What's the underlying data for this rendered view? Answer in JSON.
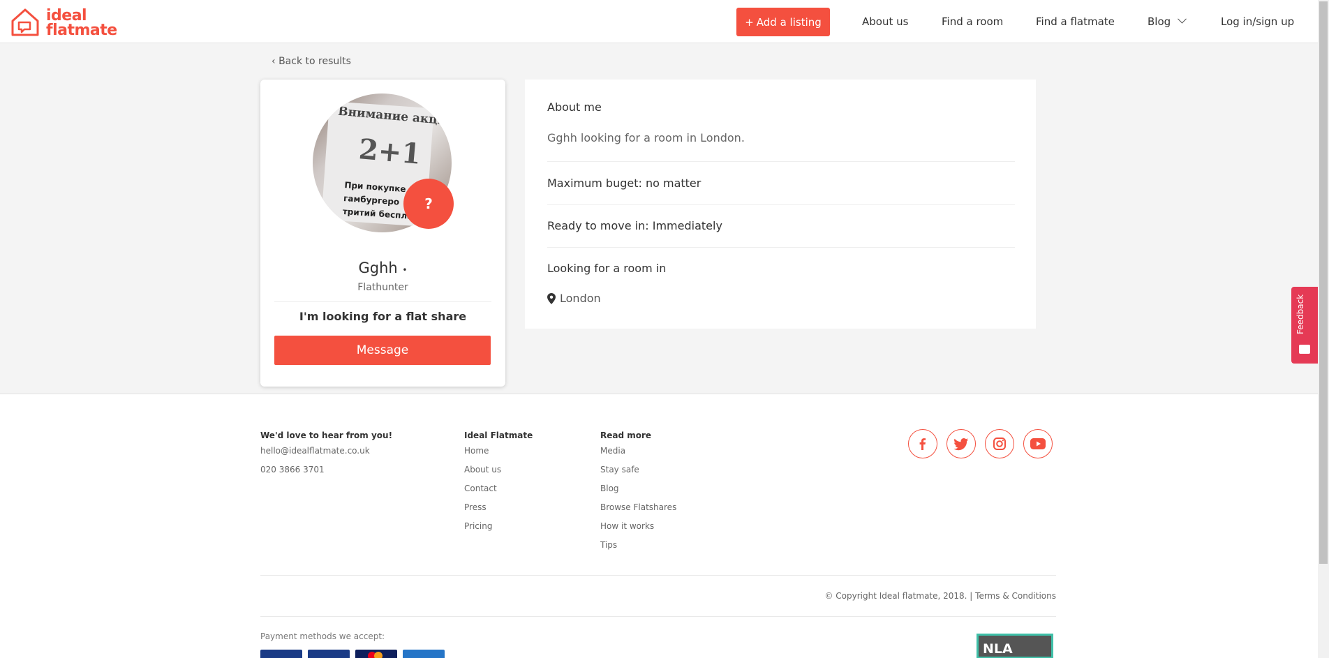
{
  "header": {
    "logo_line1": "ideal",
    "logo_line2": "flatmate",
    "add_listing": "Add a listing",
    "nav": [
      "About us",
      "Find a room",
      "Find a flatmate",
      "Blog",
      "Log in/sign up"
    ]
  },
  "back_link": "Back to results",
  "profile": {
    "avatar_line1": "Внимание акция!!!",
    "avatar_line2": "2+1",
    "avatar_line3a": "При покупке д",
    "avatar_line3b": "гамбургеро",
    "avatar_line3c": "тритий бесплатн",
    "badge": "?",
    "name": "Gghh",
    "role": "Flathunter",
    "looking": "I'm looking for a flat share",
    "message_button": "Message"
  },
  "about": {
    "heading": "About me",
    "text": "Gghh looking for a room in London.",
    "budget": "Maximum buget: no matter",
    "move_in": "Ready to move in: Immediately",
    "looking_in_heading": "Looking for a room in",
    "location": "London"
  },
  "feedback": "Feedback",
  "footer": {
    "col1_head": "We'd love to hear from you!",
    "col1_links": [
      "hello@idealflatmate.co.uk",
      "020 3866 3701"
    ],
    "col2_head": "Ideal Flatmate",
    "col2_links": [
      "Home",
      "About us",
      "Contact",
      "Press",
      "Pricing"
    ],
    "col3_head": "Read more",
    "col3_links": [
      "Media",
      "Stay safe",
      "Blog",
      "Browse Flatshares",
      "How it works",
      "Tips"
    ],
    "social": [
      "facebook-icon",
      "twitter-icon",
      "instagram-icon",
      "youtube-icon"
    ],
    "copyright": "© Copyright Ideal flatmate, 2018. | Terms & Conditions",
    "payment_label": "Payment methods we accept:",
    "nla": "NLA"
  },
  "colors": {
    "accent": "#f4503f",
    "feedback": "#e53a55"
  }
}
